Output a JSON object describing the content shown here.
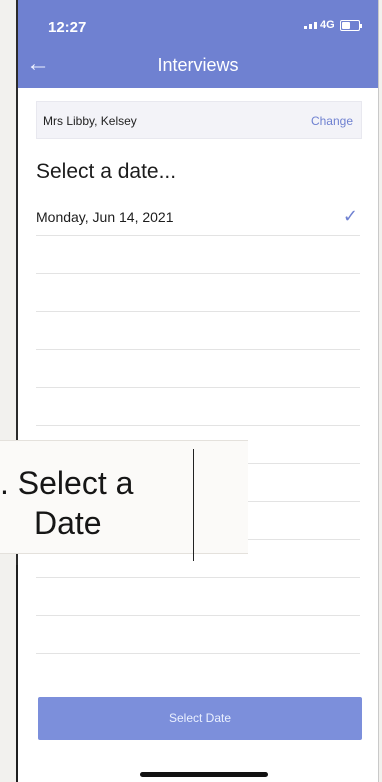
{
  "status_bar": {
    "time": "12:27",
    "network": "4G"
  },
  "header": {
    "title": "Interviews"
  },
  "teacher": {
    "name": "Mrs Libby, Kelsey",
    "action": "Change"
  },
  "section": {
    "title": "Select a date..."
  },
  "dates": [
    {
      "label": "Monday, Jun 14, 2021",
      "selected": true
    }
  ],
  "button": {
    "label": "Select Date"
  },
  "callout": {
    "line1": ". Select a",
    "line2": "Date"
  },
  "colors": {
    "accent": "#6f81d1",
    "button": "#7c8fdb"
  }
}
